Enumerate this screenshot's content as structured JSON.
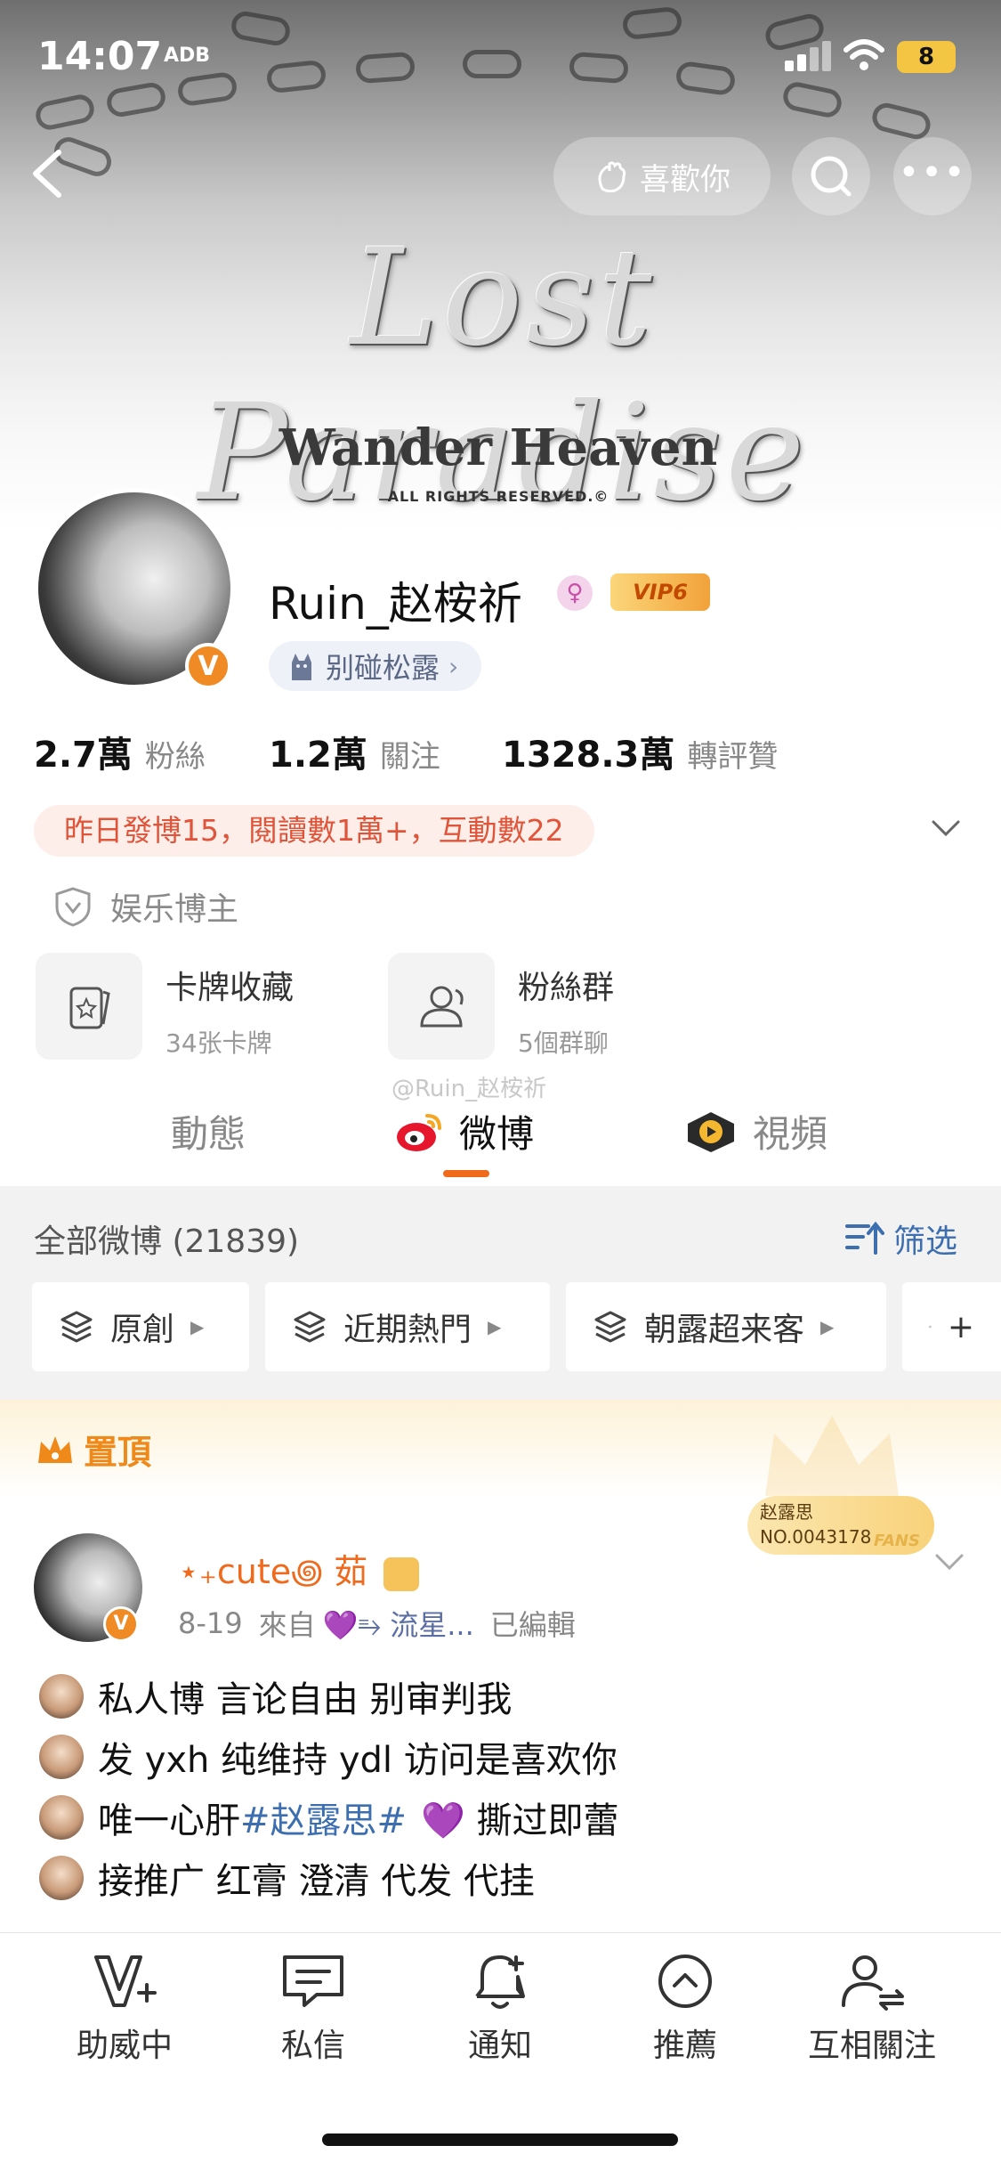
{
  "status_bar": {
    "time": "14:07",
    "sub_label": "ADB",
    "battery": "8"
  },
  "header": {
    "like_button_label": "喜歡你",
    "cover_title": "Lost Paradise",
    "cover_subtitle": "Wander Heaven",
    "cover_rights": "ALL RIGHTS RESERVED.©"
  },
  "profile": {
    "username": "Ruin_赵桉祈",
    "gender_icon": "♀",
    "vip_label": "VIP6",
    "verify_mark": "V",
    "super_tag": "别碰松露",
    "stats": [
      {
        "value": "2.7萬",
        "label": "粉絲"
      },
      {
        "value": "1.2萬",
        "label": "關注"
      },
      {
        "value": "1328.3萬",
        "label": "轉評贊"
      }
    ],
    "daily_summary": "昨日發博15，閱讀數1萬+，互動數22",
    "category": "娱乐博主"
  },
  "features": [
    {
      "title": "卡牌收藏",
      "sub": "34张卡牌",
      "icon": "card-icon"
    },
    {
      "title": "粉絲群",
      "sub": "5個群聊",
      "icon": "group-icon"
    }
  ],
  "watermark": "@Ruin_赵桉祈",
  "tabs": [
    {
      "label": "動態"
    },
    {
      "label": "微博"
    },
    {
      "label": "視頻"
    }
  ],
  "feed": {
    "all_posts_label": "全部微博 (21839)",
    "filter_label": "筛选",
    "chips": [
      "原創",
      "近期熱門",
      "朝露超来客",
      "+"
    ],
    "pinned_label": "置頂",
    "fans_card": {
      "name": "赵露思",
      "number": "NO.0043178",
      "tag": "FANS"
    },
    "post": {
      "author": "⋆₊cute꩜ 茹",
      "date": "8-19",
      "from_label": "來自",
      "source": "💜⥱ 流星...",
      "edited": "已編輯",
      "lines": [
        {
          "text": "私人博 言论自由 别审判我"
        },
        {
          "text": "发 yxh 纯维持 ydl 访问是喜欢你"
        },
        {
          "prefix": "唯一心肝",
          "hashtag": "#赵露思#",
          "suffix": "💜 撕过即蕾"
        },
        {
          "text": "接推广 红膏 澄清 代发 代挂"
        }
      ]
    }
  },
  "bottom_nav": [
    {
      "label": "助威中",
      "icon": "cheer-icon"
    },
    {
      "label": "私信",
      "icon": "message-icon"
    },
    {
      "label": "通知",
      "icon": "bell-icon"
    },
    {
      "label": "推薦",
      "icon": "recommend-icon"
    },
    {
      "label": "互相關注",
      "icon": "mutual-follow-icon"
    }
  ],
  "colors": {
    "accent": "#f06a1c",
    "link": "#3d6fb0",
    "daily_bg": "#fdeeea",
    "daily_text": "#e0553a"
  }
}
